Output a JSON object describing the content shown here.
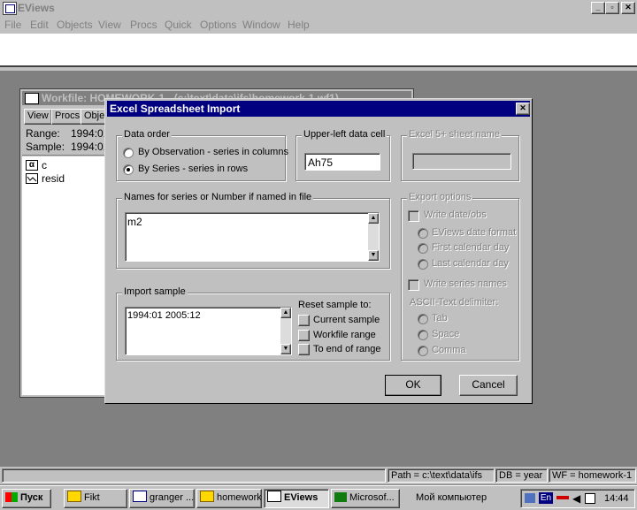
{
  "app": {
    "title": "EViews"
  },
  "menu": [
    "File",
    "Edit",
    "Objects",
    "View",
    "Procs",
    "Quick",
    "Options",
    "Window",
    "Help"
  ],
  "workfile": {
    "title": "Workfile: HOMEWORK-1 - (c:\\text\\data\\ifs\\homework-1.wf1)",
    "toolbar": [
      "View",
      "Procs",
      "Objects"
    ],
    "range_label": "Range:",
    "range_value": "1994:01 2005:12",
    "sample_label": "Sample:",
    "sample_value": "1994:01 2005:12",
    "objects": [
      "c",
      "resid"
    ]
  },
  "dialog": {
    "title": "Excel Spreadsheet Import",
    "data_order": {
      "label": "Data order",
      "options": [
        "By Observation - series in columns",
        "By Series - series in rows"
      ],
      "selected": 1
    },
    "upper_left": {
      "label": "Upper-left data cell",
      "value": "Ah75"
    },
    "sheet_name": {
      "label": "Excel 5+ sheet name",
      "value": ""
    },
    "names": {
      "label": "Names for series or Number if named in file",
      "value": "m2"
    },
    "import_sample": {
      "label": "Import sample",
      "value": "1994:01 2005:12"
    },
    "reset": {
      "label": "Reset sample to:",
      "options": [
        "Current sample",
        "Workfile range",
        "To end of range"
      ]
    },
    "export": {
      "label": "Export options",
      "write_date": "Write date/obs",
      "date_options": [
        "EViews date format",
        "First calendar day",
        "Last calendar day"
      ],
      "write_names": "Write series names",
      "delim_label": "ASCII-Text delimiter:",
      "delim_options": [
        "Tab",
        "Space",
        "Comma"
      ]
    },
    "ok": "OK",
    "cancel": "Cancel"
  },
  "status": {
    "path": "Path = c:\\text\\data\\ifs",
    "db": "DB = year",
    "wf": "WF = homework-1"
  },
  "taskbar": {
    "start": "Пуск",
    "tasks": [
      "Fikt",
      "granger ...",
      "homework",
      "EViews",
      "Microsof..."
    ],
    "tray_text": "Мой компьютер",
    "lang": "En",
    "clock": "14:44"
  }
}
